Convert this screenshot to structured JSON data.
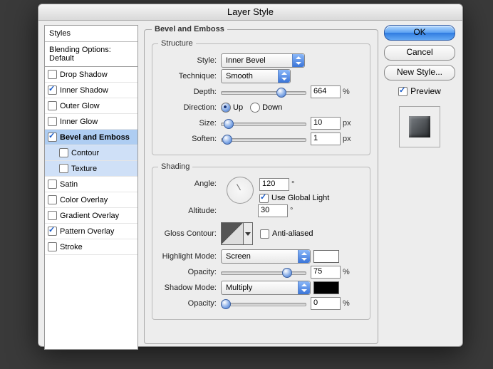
{
  "window": {
    "title": "Layer Style"
  },
  "sidebar": {
    "header_styles": "Styles",
    "header_blending": "Blending Options: Default",
    "items": [
      {
        "label": "Drop Shadow",
        "checked": false,
        "selected": false
      },
      {
        "label": "Inner Shadow",
        "checked": true,
        "selected": false
      },
      {
        "label": "Outer Glow",
        "checked": false,
        "selected": false
      },
      {
        "label": "Inner Glow",
        "checked": false,
        "selected": false
      },
      {
        "label": "Bevel and Emboss",
        "checked": true,
        "selected": true
      },
      {
        "label": "Contour",
        "checked": false,
        "selected": false,
        "sub": true
      },
      {
        "label": "Texture",
        "checked": false,
        "selected": false,
        "sub": true
      },
      {
        "label": "Satin",
        "checked": false,
        "selected": false
      },
      {
        "label": "Color Overlay",
        "checked": false,
        "selected": false
      },
      {
        "label": "Gradient Overlay",
        "checked": false,
        "selected": false
      },
      {
        "label": "Pattern Overlay",
        "checked": true,
        "selected": false
      },
      {
        "label": "Stroke",
        "checked": false,
        "selected": false
      }
    ]
  },
  "panel": {
    "title": "Bevel and Emboss",
    "structure": {
      "legend": "Structure",
      "style_label": "Style:",
      "style_value": "Inner Bevel",
      "technique_label": "Technique:",
      "technique_value": "Smooth",
      "depth_label": "Depth:",
      "depth_value": "664",
      "depth_unit": "%",
      "direction_label": "Direction:",
      "direction_up": "Up",
      "direction_down": "Down",
      "direction_value": "Up",
      "size_label": "Size:",
      "size_value": "10",
      "size_unit": "px",
      "soften_label": "Soften:",
      "soften_value": "1",
      "soften_unit": "px"
    },
    "shading": {
      "legend": "Shading",
      "angle_label": "Angle:",
      "angle_value": "120",
      "angle_unit": "°",
      "global_light_label": "Use Global Light",
      "global_light_checked": true,
      "altitude_label": "Altitude:",
      "altitude_value": "30",
      "altitude_unit": "°",
      "gloss_contour_label": "Gloss Contour:",
      "anti_aliased_label": "Anti-aliased",
      "anti_aliased_checked": false,
      "highlight_mode_label": "Highlight Mode:",
      "highlight_mode_value": "Screen",
      "highlight_color": "#ffffff",
      "highlight_opacity_label": "Opacity:",
      "highlight_opacity_value": "75",
      "opacity_unit": "%",
      "shadow_mode_label": "Shadow Mode:",
      "shadow_mode_value": "Multiply",
      "shadow_color": "#000000",
      "shadow_opacity_label": "Opacity:",
      "shadow_opacity_value": "0"
    }
  },
  "buttons": {
    "ok": "OK",
    "cancel": "Cancel",
    "new_style": "New Style...",
    "preview": "Preview"
  }
}
